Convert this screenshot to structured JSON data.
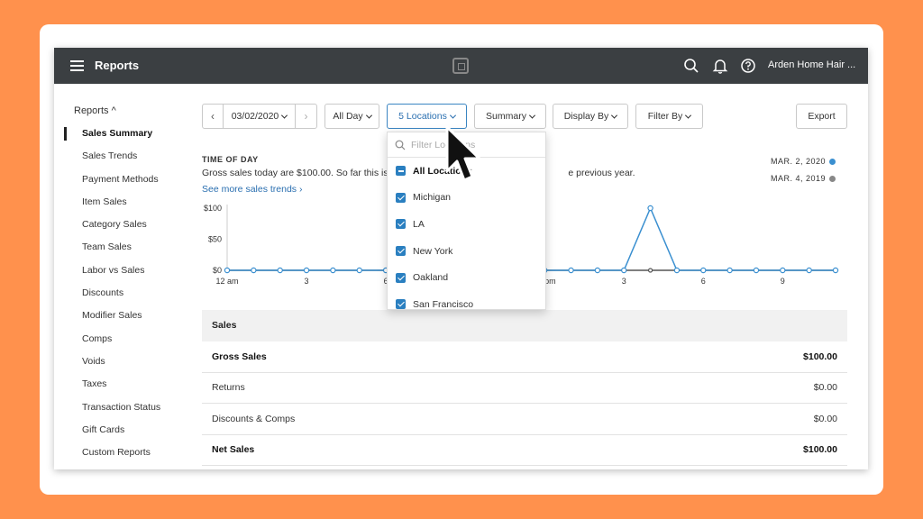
{
  "topbar": {
    "title": "Reports",
    "account": "Arden Home Hair ..."
  },
  "sidebar": {
    "heading": "Reports ^",
    "items": [
      {
        "label": "Sales Summary",
        "active": true
      },
      {
        "label": "Sales Trends"
      },
      {
        "label": "Payment Methods"
      },
      {
        "label": "Item Sales"
      },
      {
        "label": "Category Sales"
      },
      {
        "label": "Team Sales"
      },
      {
        "label": "Labor vs Sales"
      },
      {
        "label": "Discounts"
      },
      {
        "label": "Modifier Sales"
      },
      {
        "label": "Comps"
      },
      {
        "label": "Voids"
      },
      {
        "label": "Taxes"
      },
      {
        "label": "Transaction Status"
      },
      {
        "label": "Gift Cards"
      },
      {
        "label": "Custom Reports"
      }
    ]
  },
  "toolbar": {
    "prev": "‹",
    "date": "03/02/2020",
    "next": "›",
    "time": "All Day",
    "locations": "5 Locations",
    "summary": "Summary",
    "display_by": "Display By",
    "filter_by": "Filter By",
    "export": "Export"
  },
  "summary": {
    "heading": "TIME OF DAY",
    "gross_text": "Gross sales today are $100.00. So far this is u",
    "gross_text_end": "e previous year.",
    "link": "See more sales trends ›",
    "legend": [
      {
        "label": "MAR. 2, 2020",
        "color": "#3a8fd0"
      },
      {
        "label": "MAR. 4, 2019",
        "color": "#888888"
      }
    ]
  },
  "chart_data": {
    "type": "line",
    "y_ticks": [
      "$100",
      "$50",
      "$0"
    ],
    "ylim": [
      0,
      100
    ],
    "x_tick_labels": [
      "12 am",
      "3",
      "6",
      "9",
      "12 pm",
      "3",
      "6",
      "9"
    ],
    "series": [
      {
        "name": "MAR. 2, 2020",
        "color": "#3a8fd0",
        "values": [
          0,
          0,
          0,
          0,
          0,
          0,
          0,
          0,
          0,
          0,
          0,
          0,
          0,
          0,
          0,
          0,
          100,
          0,
          0,
          0,
          0,
          0,
          0,
          0
        ]
      },
      {
        "name": "MAR. 4, 2019",
        "color": "#555555",
        "values": [
          0,
          0,
          0,
          0,
          0,
          0,
          0,
          0,
          0,
          0,
          0,
          0,
          0,
          0,
          0,
          0,
          0,
          0,
          0,
          0,
          0,
          0,
          0,
          0
        ]
      }
    ]
  },
  "sales_table": {
    "header": "Sales",
    "rows": [
      {
        "label": "Gross Sales",
        "value": "$100.00",
        "bold": true
      },
      {
        "label": "Returns",
        "value": "$0.00"
      },
      {
        "label": "Discounts & Comps",
        "value": "$0.00"
      },
      {
        "label": "Net Sales",
        "value": "$100.00",
        "bold": true
      }
    ]
  },
  "locations_dropdown": {
    "placeholder": "Filter Locations",
    "all_label": "All Locations",
    "items": [
      "Michigan",
      "LA",
      "New York",
      "Oakland",
      "San Francisco"
    ]
  }
}
